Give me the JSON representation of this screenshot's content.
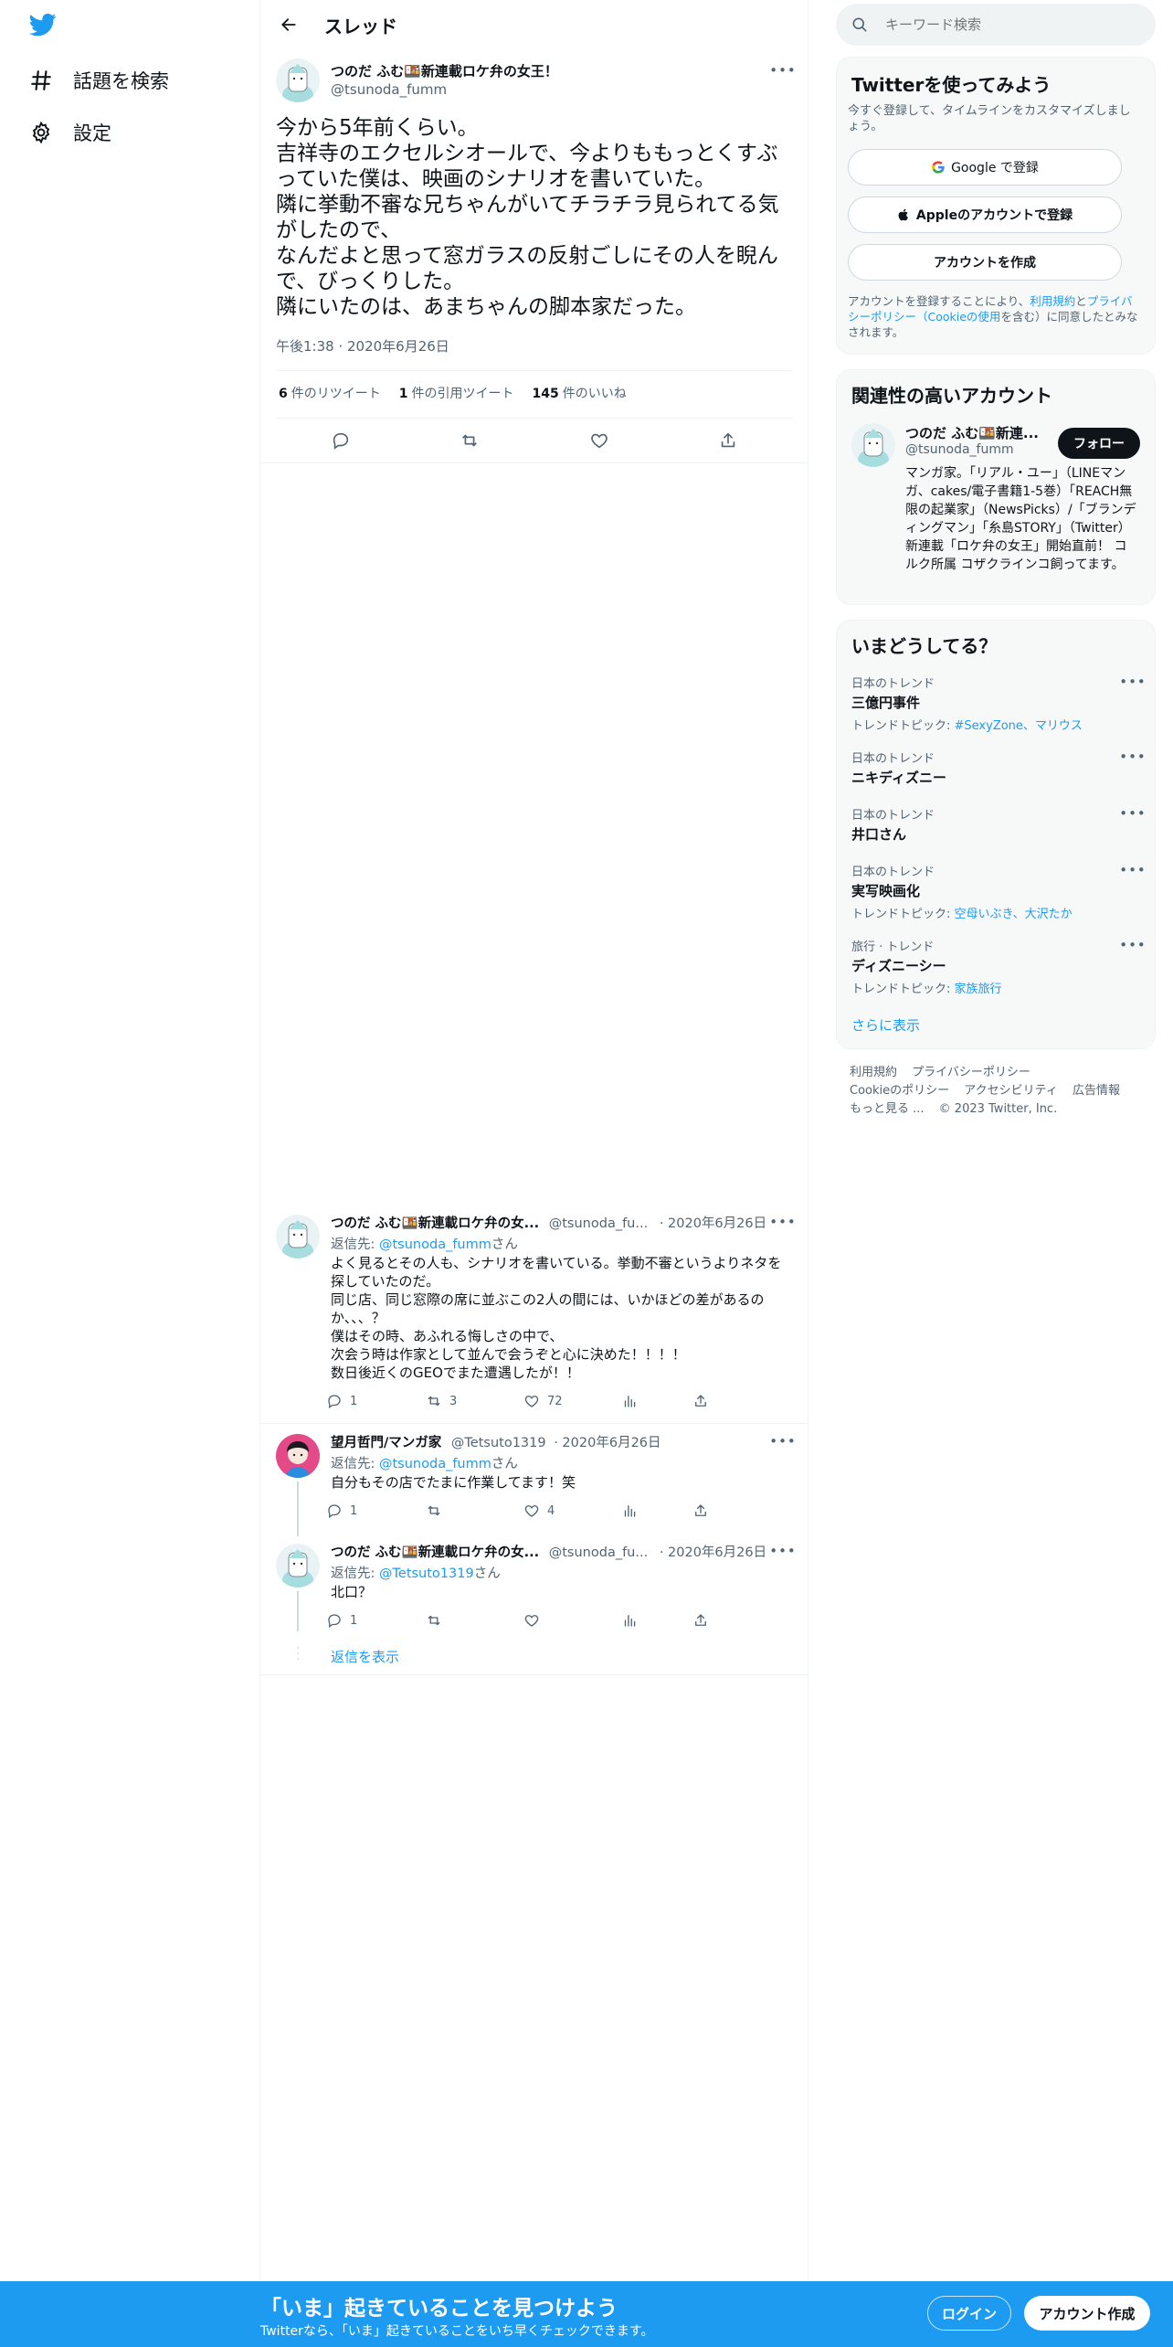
{
  "colors": {
    "brand": "#1d9bf0",
    "text": "#0f1419",
    "muted": "#536471",
    "like_pink": "#f91880"
  },
  "nav": {
    "logo_icon": "twitter-bird-icon",
    "items": [
      {
        "label": "話題を検索",
        "icon": "hashtag-icon"
      },
      {
        "label": "設定",
        "icon": "gear-icon"
      }
    ]
  },
  "header": {
    "title": "スレッド",
    "back_icon": "arrow-left-icon"
  },
  "focus_tweet": {
    "author_name": "つのだ ふむ🍱新連載ロケ弁の女王！",
    "author_handle": "@tsunoda_fumm",
    "lines": [
      "今から5年前くらい。",
      "吉祥寺のエクセルシオールで、今よりももっとくすぶっていた僕は、映画のシナリオを書いていた。",
      "隣に挙動不審な兄ちゃんがいてチラチラ見られてる気がしたので、",
      "なんだよと思って窓ガラスの反射ごしにその人を睨んで、びっくりした。",
      "隣にいたのは、あまちゃんの脚本家だった。"
    ],
    "time": "午後1:38 · 2020年6月26日",
    "stats": [
      {
        "count": "6",
        "label": "件のリツイート"
      },
      {
        "count": "1",
        "label": "件の引用ツイート"
      },
      {
        "count": "145",
        "label": "件のいいね"
      }
    ]
  },
  "replies": [
    {
      "author_name": "つのだ ふむ🍱新連載ロケ弁の女...",
      "author_handle": "@tsunoda_fu...",
      "date": "· 2020年6月26日",
      "reply_label": "返信先: ",
      "reply_to": "@tsunoda_fumm",
      "reply_suffix": "さん",
      "lines": [
        "よく見るとその人も、シナリオを書いている。挙動不審というよりネタを探していたのだ。",
        "同じ店、同じ窓際の席に並ぶこの2人の間には、いかほどの差があるのか、、、？",
        "僕はその時、あふれる悔しさの中で、",
        "次会う時は作家として並んで会うぞと心に決めた！！！！",
        "数日後近くのGEOでまた遭遇したが！！"
      ],
      "replies": "1",
      "retweets": "3",
      "likes": "72"
    },
    {
      "author_name": "望月哲門/マンガ家",
      "author_handle": "@Tetsuto1319",
      "date": "· 2020年6月26日",
      "reply_label": "返信先: ",
      "reply_to": "@tsunoda_fumm",
      "reply_suffix": "さん",
      "lines": [
        "自分もその店でたまに作業してます！笑"
      ],
      "replies": "1",
      "retweets": "",
      "likes": "4"
    },
    {
      "author_name": "つのだ ふむ🍱新連載ロケ弁の女...",
      "author_handle": "@tsunoda_fu...",
      "date": "· 2020年6月26日",
      "reply_label": "返信先: ",
      "reply_to": "@Tetsuto1319",
      "reply_suffix": "さん",
      "lines": [
        "北口？"
      ],
      "replies": "1",
      "retweets": "",
      "likes": ""
    }
  ],
  "show_replies": "返信を表示",
  "search": {
    "placeholder": "キーワード検索"
  },
  "signup_panel": {
    "title": "Twitterを使ってみよう",
    "subtitle": "今すぐ登録して、タイムラインをカスタマイズしましょう。",
    "google_button": "Google で登録",
    "apple_button": "Appleのアカウントで登録",
    "create_button": "アカウントを作成",
    "terms_prefix": "アカウントを登録することにより、",
    "terms_link": "利用規約",
    "terms_and": "と",
    "privacy_link": "プライバシーポリシー（Cookieの使用",
    "terms_suffix": "を含む）に同意したとみなされます。"
  },
  "related_panel": {
    "title": "関連性の高いアカウント",
    "name": "つのだ ふむ🍱新連...",
    "handle": "@tsunoda_fumm",
    "follow_button": "フォロー",
    "bio": "マンガ家。「リアル・ユー」（LINEマンガ、cakes/電子書籍1-5巻）「REACH無限の起業家」（NewsPicks）/「ブランディングマン」「糸島STORY」（Twitter） 新連載「ロケ弁の女王」開始直前！ コルク所属 コザクラインコ飼ってます。"
  },
  "trends_panel": {
    "title": "いまどうしてる？",
    "items": [
      {
        "context": "日本のトレンド",
        "name": "三億円事件",
        "topic_prefix": "トレンドトピック: ",
        "topic": "#SexyZone、マリウス"
      },
      {
        "context": "日本のトレンド",
        "name": "ニキディズニー",
        "topic_prefix": "",
        "topic": ""
      },
      {
        "context": "日本のトレンド",
        "name": "井口さん",
        "topic_prefix": "",
        "topic": ""
      },
      {
        "context": "日本のトレンド",
        "name": "実写映画化",
        "topic_prefix": "トレンドトピック: ",
        "topic": "空母いぶき、大沢たか"
      },
      {
        "context": "旅行 · トレンド",
        "name": "ディズニーシー",
        "topic_prefix": "トレンドトピック: ",
        "topic": "家族旅行"
      }
    ],
    "show_more": "さらに表示"
  },
  "footer": {
    "links": [
      "利用規約",
      "プライバシーポリシー",
      "Cookieのポリシー",
      "アクセシビリティ",
      "広告情報",
      "もっと見る ..."
    ],
    "copyright": "© 2023 Twitter, Inc."
  },
  "bottom_bar": {
    "title": "「いま」起きていることを見つけよう",
    "subtitle": "Twitterなら、「いま」起きていることをいち早くチェックできます。",
    "login": "ログイン",
    "signup": "アカウント作成"
  }
}
